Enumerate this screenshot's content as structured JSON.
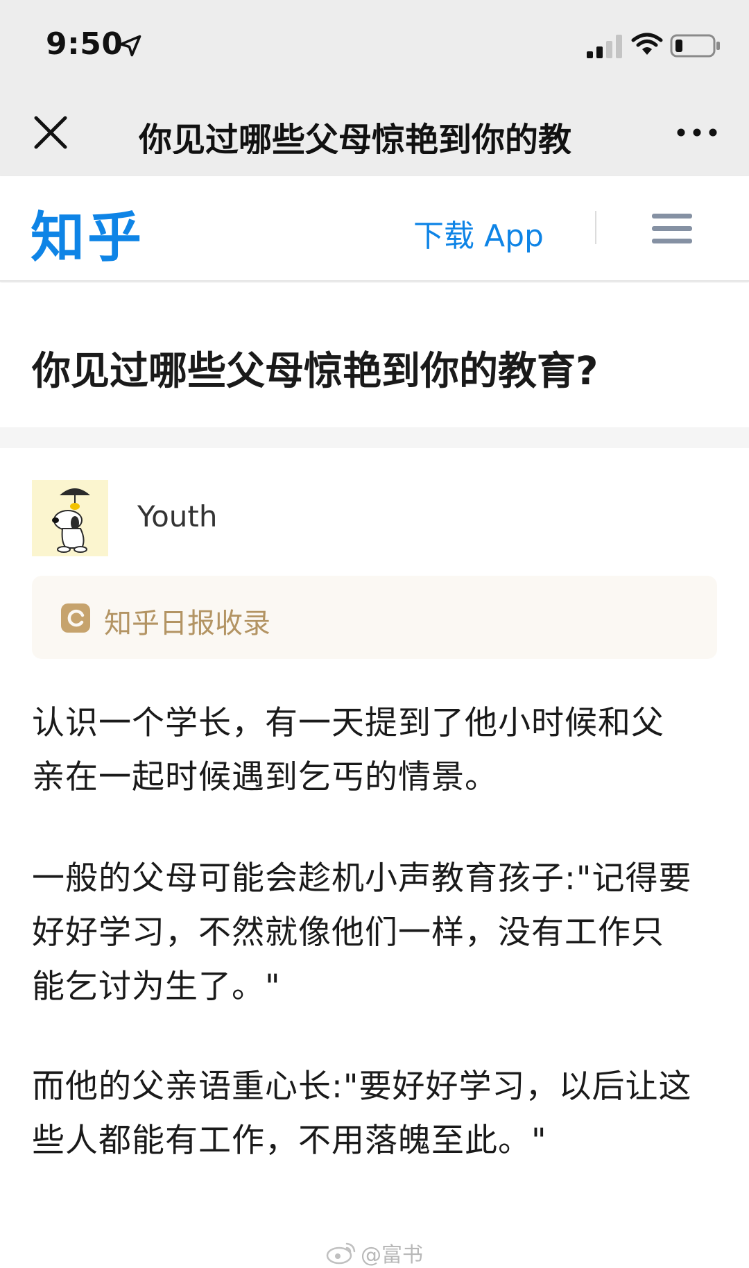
{
  "status_bar": {
    "time": "9:50"
  },
  "nav": {
    "title": "你见过哪些父母惊艳到你的教"
  },
  "header": {
    "logo": "知乎",
    "download_label": "下载 App",
    "brand_color": "#0e84e6"
  },
  "question": {
    "title": "你见过哪些父母惊艳到你的教育?"
  },
  "answer": {
    "author": "Youth",
    "daily_badge": "知乎日报收录",
    "paragraphs": [
      [
        "认识一个学长，有一天提到了他小时候和父",
        "亲在一起时候遇到乞丐的情景。"
      ],
      [
        "一般的父母可能会趁机小声教育孩子:\"记得要",
        "好好学习，不然就像他们一样，没有工作只",
        "能乞讨为生了。\""
      ],
      [
        "而他的父亲语重心长:\"要好好学习，以后让这",
        "些人都能有工作，不用落魄至此。\""
      ]
    ]
  },
  "watermark": {
    "text": "@富书"
  }
}
